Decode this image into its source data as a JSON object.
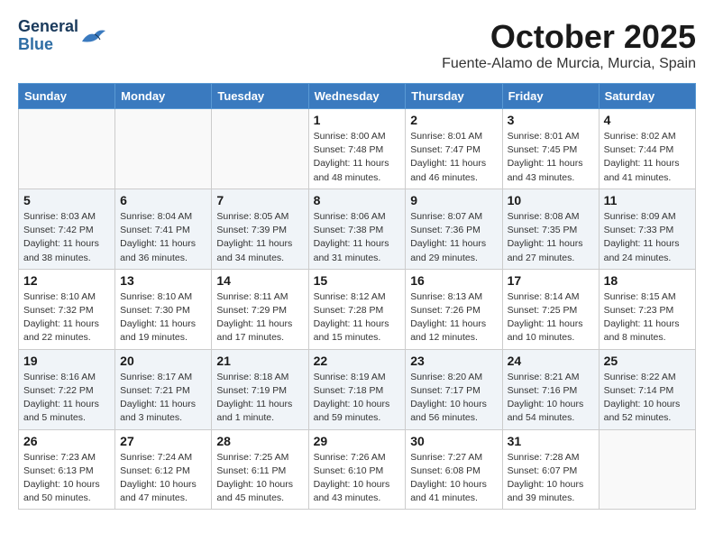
{
  "logo": {
    "line1": "General",
    "line2": "Blue"
  },
  "header": {
    "month": "October 2025",
    "location": "Fuente-Alamo de Murcia, Murcia, Spain"
  },
  "weekdays": [
    "Sunday",
    "Monday",
    "Tuesday",
    "Wednesday",
    "Thursday",
    "Friday",
    "Saturday"
  ],
  "weeks": [
    [
      {
        "day": "",
        "info": ""
      },
      {
        "day": "",
        "info": ""
      },
      {
        "day": "",
        "info": ""
      },
      {
        "day": "1",
        "info": "Sunrise: 8:00 AM\nSunset: 7:48 PM\nDaylight: 11 hours\nand 48 minutes."
      },
      {
        "day": "2",
        "info": "Sunrise: 8:01 AM\nSunset: 7:47 PM\nDaylight: 11 hours\nand 46 minutes."
      },
      {
        "day": "3",
        "info": "Sunrise: 8:01 AM\nSunset: 7:45 PM\nDaylight: 11 hours\nand 43 minutes."
      },
      {
        "day": "4",
        "info": "Sunrise: 8:02 AM\nSunset: 7:44 PM\nDaylight: 11 hours\nand 41 minutes."
      }
    ],
    [
      {
        "day": "5",
        "info": "Sunrise: 8:03 AM\nSunset: 7:42 PM\nDaylight: 11 hours\nand 38 minutes."
      },
      {
        "day": "6",
        "info": "Sunrise: 8:04 AM\nSunset: 7:41 PM\nDaylight: 11 hours\nand 36 minutes."
      },
      {
        "day": "7",
        "info": "Sunrise: 8:05 AM\nSunset: 7:39 PM\nDaylight: 11 hours\nand 34 minutes."
      },
      {
        "day": "8",
        "info": "Sunrise: 8:06 AM\nSunset: 7:38 PM\nDaylight: 11 hours\nand 31 minutes."
      },
      {
        "day": "9",
        "info": "Sunrise: 8:07 AM\nSunset: 7:36 PM\nDaylight: 11 hours\nand 29 minutes."
      },
      {
        "day": "10",
        "info": "Sunrise: 8:08 AM\nSunset: 7:35 PM\nDaylight: 11 hours\nand 27 minutes."
      },
      {
        "day": "11",
        "info": "Sunrise: 8:09 AM\nSunset: 7:33 PM\nDaylight: 11 hours\nand 24 minutes."
      }
    ],
    [
      {
        "day": "12",
        "info": "Sunrise: 8:10 AM\nSunset: 7:32 PM\nDaylight: 11 hours\nand 22 minutes."
      },
      {
        "day": "13",
        "info": "Sunrise: 8:10 AM\nSunset: 7:30 PM\nDaylight: 11 hours\nand 19 minutes."
      },
      {
        "day": "14",
        "info": "Sunrise: 8:11 AM\nSunset: 7:29 PM\nDaylight: 11 hours\nand 17 minutes."
      },
      {
        "day": "15",
        "info": "Sunrise: 8:12 AM\nSunset: 7:28 PM\nDaylight: 11 hours\nand 15 minutes."
      },
      {
        "day": "16",
        "info": "Sunrise: 8:13 AM\nSunset: 7:26 PM\nDaylight: 11 hours\nand 12 minutes."
      },
      {
        "day": "17",
        "info": "Sunrise: 8:14 AM\nSunset: 7:25 PM\nDaylight: 11 hours\nand 10 minutes."
      },
      {
        "day": "18",
        "info": "Sunrise: 8:15 AM\nSunset: 7:23 PM\nDaylight: 11 hours\nand 8 minutes."
      }
    ],
    [
      {
        "day": "19",
        "info": "Sunrise: 8:16 AM\nSunset: 7:22 PM\nDaylight: 11 hours\nand 5 minutes."
      },
      {
        "day": "20",
        "info": "Sunrise: 8:17 AM\nSunset: 7:21 PM\nDaylight: 11 hours\nand 3 minutes."
      },
      {
        "day": "21",
        "info": "Sunrise: 8:18 AM\nSunset: 7:19 PM\nDaylight: 11 hours\nand 1 minute."
      },
      {
        "day": "22",
        "info": "Sunrise: 8:19 AM\nSunset: 7:18 PM\nDaylight: 10 hours\nand 59 minutes."
      },
      {
        "day": "23",
        "info": "Sunrise: 8:20 AM\nSunset: 7:17 PM\nDaylight: 10 hours\nand 56 minutes."
      },
      {
        "day": "24",
        "info": "Sunrise: 8:21 AM\nSunset: 7:16 PM\nDaylight: 10 hours\nand 54 minutes."
      },
      {
        "day": "25",
        "info": "Sunrise: 8:22 AM\nSunset: 7:14 PM\nDaylight: 10 hours\nand 52 minutes."
      }
    ],
    [
      {
        "day": "26",
        "info": "Sunrise: 7:23 AM\nSunset: 6:13 PM\nDaylight: 10 hours\nand 50 minutes."
      },
      {
        "day": "27",
        "info": "Sunrise: 7:24 AM\nSunset: 6:12 PM\nDaylight: 10 hours\nand 47 minutes."
      },
      {
        "day": "28",
        "info": "Sunrise: 7:25 AM\nSunset: 6:11 PM\nDaylight: 10 hours\nand 45 minutes."
      },
      {
        "day": "29",
        "info": "Sunrise: 7:26 AM\nSunset: 6:10 PM\nDaylight: 10 hours\nand 43 minutes."
      },
      {
        "day": "30",
        "info": "Sunrise: 7:27 AM\nSunset: 6:08 PM\nDaylight: 10 hours\nand 41 minutes."
      },
      {
        "day": "31",
        "info": "Sunrise: 7:28 AM\nSunset: 6:07 PM\nDaylight: 10 hours\nand 39 minutes."
      },
      {
        "day": "",
        "info": ""
      }
    ]
  ]
}
